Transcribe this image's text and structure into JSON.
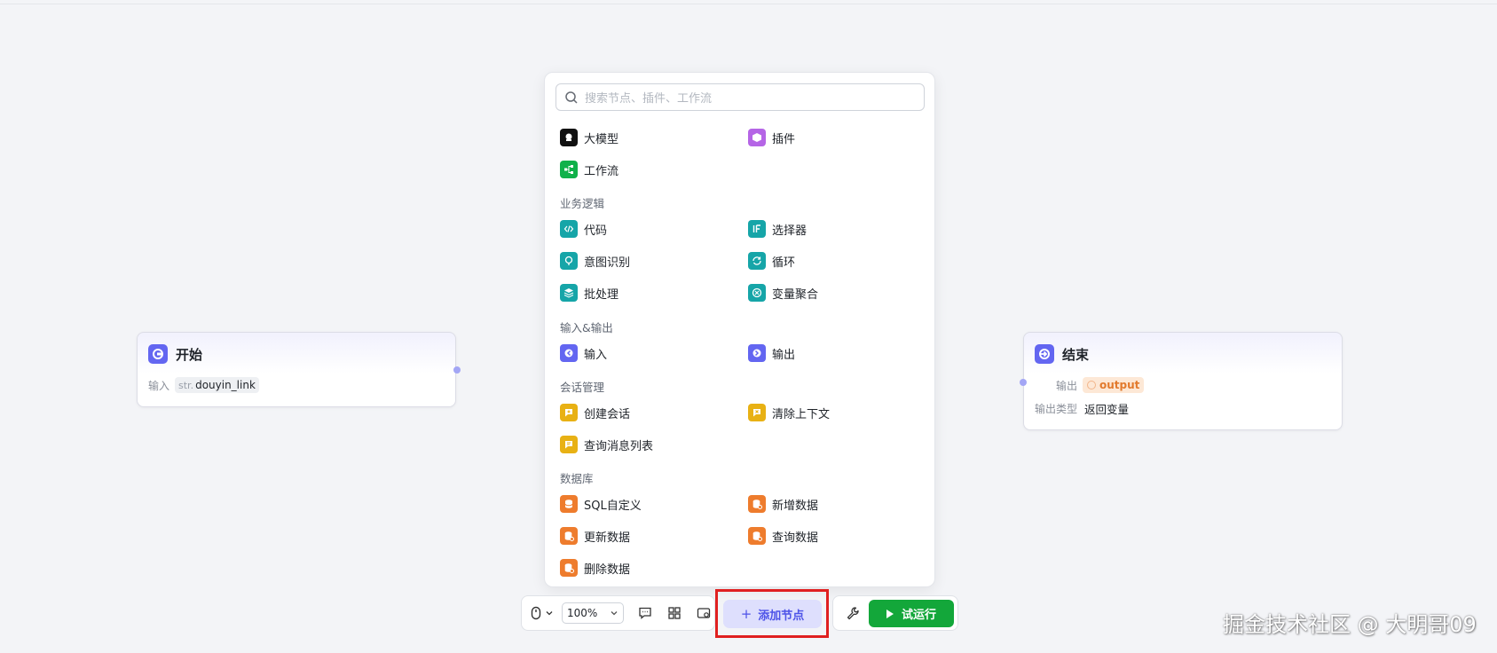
{
  "canvas": {
    "background": "#f3f4f7"
  },
  "start_node": {
    "title": "开始",
    "input_label": "输入",
    "param_type": "str.",
    "param_name": "douyin_link"
  },
  "end_node": {
    "title": "结束",
    "output_label": "输出",
    "output_var": "output",
    "output_type_label": "输出类型",
    "output_type_value": "返回变量"
  },
  "panel": {
    "search_placeholder": "搜索节点、插件、工作流",
    "top_items": [
      {
        "label": "大模型",
        "icon": "llm-icon",
        "color": "#111111"
      },
      {
        "label": "插件",
        "icon": "plugin-icon",
        "color": "#b565e6"
      },
      {
        "label": "工作流",
        "icon": "workflow-icon",
        "color": "#10b14a"
      }
    ],
    "sections": [
      {
        "title": "业务逻辑",
        "items": [
          {
            "label": "代码",
            "icon": "code-icon"
          },
          {
            "label": "选择器",
            "icon": "selector-icon"
          },
          {
            "label": "意图识别",
            "icon": "intent-icon"
          },
          {
            "label": "循环",
            "icon": "loop-icon"
          },
          {
            "label": "批处理",
            "icon": "batch-icon"
          },
          {
            "label": "变量聚合",
            "icon": "variable-merge-icon"
          }
        ]
      },
      {
        "title": "输入&输出",
        "items": [
          {
            "label": "输入",
            "icon": "input-icon"
          },
          {
            "label": "输出",
            "icon": "output-icon"
          }
        ]
      },
      {
        "title": "会话管理",
        "items": [
          {
            "label": "创建会话",
            "icon": "create-chat-icon"
          },
          {
            "label": "清除上下文",
            "icon": "clear-context-icon"
          },
          {
            "label": "查询消息列表",
            "icon": "message-list-icon"
          }
        ]
      },
      {
        "title": "数据库",
        "items": [
          {
            "label": "SQL自定义",
            "icon": "database-icon"
          },
          {
            "label": "新增数据",
            "icon": "database-add-icon"
          },
          {
            "label": "更新数据",
            "icon": "database-update-icon"
          },
          {
            "label": "查询数据",
            "icon": "database-query-icon"
          },
          {
            "label": "删除数据",
            "icon": "database-delete-icon"
          }
        ]
      }
    ]
  },
  "toolbar": {
    "zoom": "100%",
    "add_node_label": "添加节点",
    "run_label": "试运行"
  },
  "colors": {
    "accent": "#4d53e8",
    "run_green": "#13a73a",
    "highlight_red": "#e02020",
    "teal": "#16a5a8",
    "yellow": "#e8b114",
    "orange": "#ee7c2d",
    "indigo": "#6366f1"
  },
  "watermark": "掘金技术社区 @ 大明哥09"
}
